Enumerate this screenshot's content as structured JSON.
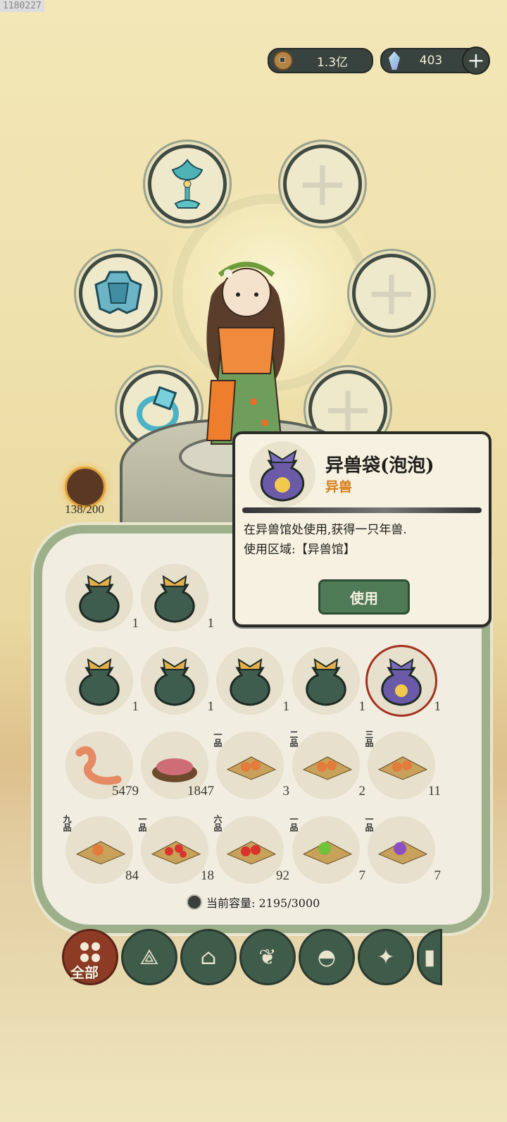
{
  "watermark": "1180227",
  "currency": {
    "coins": "1.3亿",
    "gems": "403"
  },
  "avatar": {
    "count": "138/200"
  },
  "tooltip": {
    "title": "异兽袋(泡泡)",
    "category": "异兽",
    "description_line1": "在异兽馆处使用,获得一只年兽.",
    "description_line2": "使用区域:【异兽馆】",
    "use_button": "使用"
  },
  "inventory": {
    "row1": [
      {
        "count": "1"
      },
      {
        "count": "1"
      }
    ],
    "row2": [
      {
        "count": "1"
      },
      {
        "count": "1"
      },
      {
        "count": "1"
      },
      {
        "count": "1"
      },
      {
        "count": "1"
      }
    ],
    "row3": [
      {
        "grade": "",
        "count": "5479"
      },
      {
        "grade": "",
        "count": "1847"
      },
      {
        "grade": "一品",
        "count": "3"
      },
      {
        "grade": "二品",
        "count": "2"
      },
      {
        "grade": "三品",
        "count": "11"
      }
    ],
    "row4": [
      {
        "grade": "九品",
        "count": "84"
      },
      {
        "grade": "一品",
        "count": "18"
      },
      {
        "grade": "六品",
        "count": "92"
      },
      {
        "grade": "一品",
        "count": "7"
      },
      {
        "grade": "一品",
        "count": "7"
      }
    ],
    "capacity": "当前容量: 2195/3000"
  },
  "tabs": {
    "all_label": "全部"
  },
  "icons": [
    "coin-icon",
    "gem-icon",
    "plus-icon",
    "lotus-lamp-icon",
    "armor-icon",
    "ring-icon",
    "beast-bag-icon",
    "worm-icon",
    "powder-icon",
    "fruit-icon",
    "wood-icon",
    "house-icon",
    "plant-icon",
    "food-icon",
    "map-icon",
    "scroll-icon"
  ]
}
